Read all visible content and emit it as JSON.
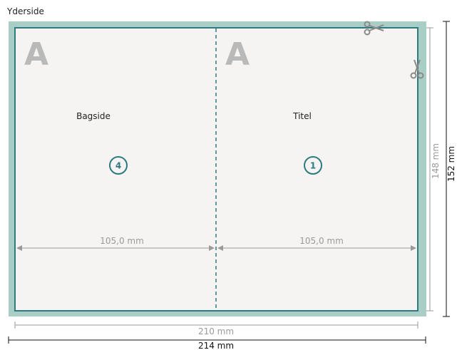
{
  "title": "Yderside",
  "panels": [
    {
      "letter": "A",
      "label": "Bagside",
      "page_number": "4",
      "width_label": "105,0 mm"
    },
    {
      "letter": "A",
      "label": "Titel",
      "page_number": "1",
      "width_label": "105,0 mm"
    }
  ],
  "dimensions": {
    "trim_height": "148 mm",
    "bleed_height": "152 mm",
    "trim_width": "210 mm",
    "bleed_width": "214 mm"
  },
  "colors": {
    "bleed": "#a9cec5",
    "trim_border": "#2f7a7f",
    "paper": "#f5f4f2",
    "fold_line": "#2f7a7f",
    "circle": "#2f7a7f",
    "watermark_letter": "#b9b9b9",
    "measure_gray": "#9a9a9a",
    "measure_dark": "#111111"
  },
  "icons": {
    "cut_marks": "scissors-icon"
  }
}
